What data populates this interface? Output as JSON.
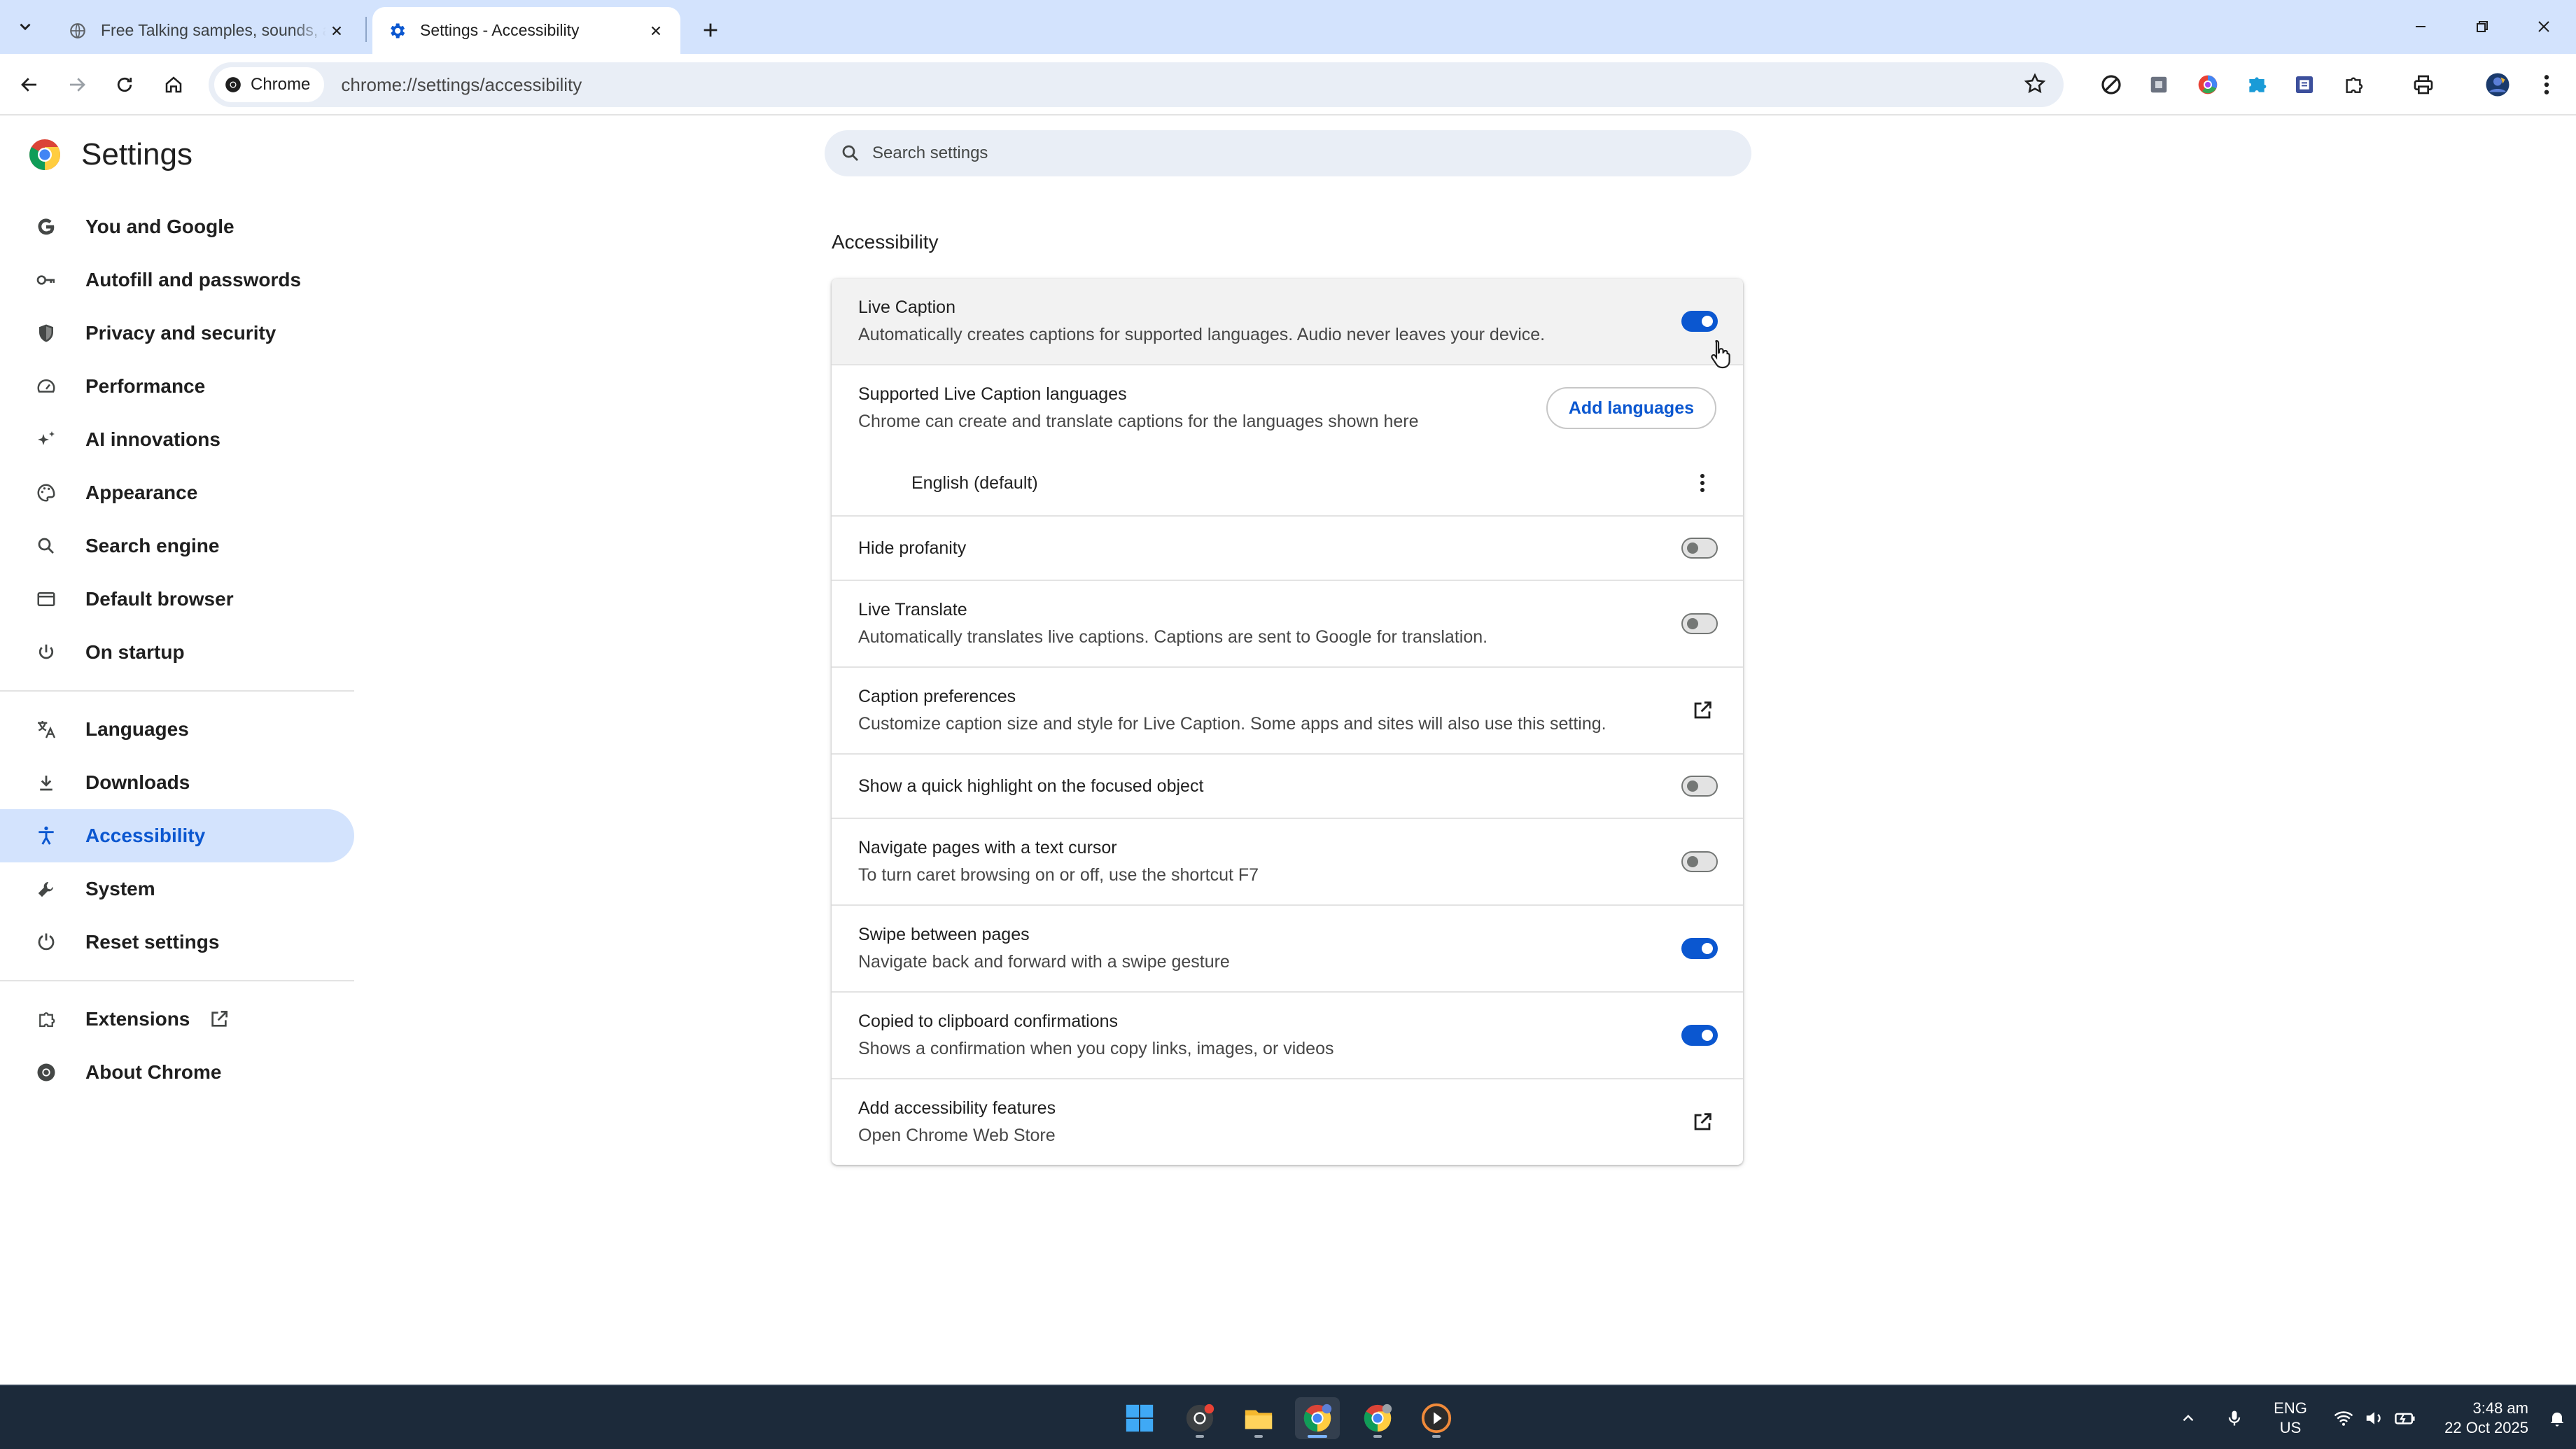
{
  "browser": {
    "tabs": [
      {
        "title": "Free Talking samples, sounds, a",
        "active": false
      },
      {
        "title": "Settings - Accessibility",
        "active": true
      }
    ],
    "omnibox": {
      "chip": "Chrome",
      "url": "chrome://settings/accessibility"
    }
  },
  "settings": {
    "title": "Settings",
    "search_placeholder": "Search settings",
    "nav": [
      {
        "label": "You and Google",
        "icon": "google-g-icon"
      },
      {
        "label": "Autofill and passwords",
        "icon": "key-icon"
      },
      {
        "label": "Privacy and security",
        "icon": "shield-icon"
      },
      {
        "label": "Performance",
        "icon": "speedometer-icon"
      },
      {
        "label": "AI innovations",
        "icon": "sparkle-icon"
      },
      {
        "label": "Appearance",
        "icon": "palette-icon"
      },
      {
        "label": "Search engine",
        "icon": "search-icon"
      },
      {
        "label": "Default browser",
        "icon": "browser-window-icon"
      },
      {
        "label": "On startup",
        "icon": "power-icon"
      },
      {
        "label": "Languages",
        "icon": "translate-icon"
      },
      {
        "label": "Downloads",
        "icon": "download-icon"
      },
      {
        "label": "Accessibility",
        "icon": "accessibility-icon",
        "selected": true
      },
      {
        "label": "System",
        "icon": "wrench-icon"
      },
      {
        "label": "Reset settings",
        "icon": "reset-icon"
      },
      {
        "label": "Extensions",
        "icon": "puzzle-icon"
      },
      {
        "label": "About Chrome",
        "icon": "chrome-icon"
      }
    ],
    "section_title": "Accessibility",
    "rows": {
      "live_caption": {
        "label": "Live Caption",
        "sub": "Automatically creates captions for supported languages. Audio never leaves your device.",
        "on": true
      },
      "supported_langs": {
        "label": "Supported Live Caption languages",
        "sub": "Chrome can create and translate captions for the languages shown here",
        "button": "Add languages"
      },
      "english": {
        "label": "English (default)"
      },
      "hide_profanity": {
        "label": "Hide profanity",
        "on": false
      },
      "live_translate": {
        "label": "Live Translate",
        "sub": "Automatically translates live captions. Captions are sent to Google for translation.",
        "on": false
      },
      "caption_prefs": {
        "label": "Caption preferences",
        "sub": "Customize caption size and style for Live Caption. Some apps and sites will also use this setting."
      },
      "quick_highlight": {
        "label": "Show a quick highlight on the focused object",
        "on": false
      },
      "text_cursor": {
        "label": "Navigate pages with a text cursor",
        "sub": "To turn caret browsing on or off, use the shortcut F7",
        "on": false
      },
      "swipe": {
        "label": "Swipe between pages",
        "sub": "Navigate back and forward with a swipe gesture",
        "on": true
      },
      "clipboard": {
        "label": "Copied to clipboard confirmations",
        "sub": "Shows a confirmation when you copy links, images, or videos",
        "on": true
      },
      "add_features": {
        "label": "Add accessibility features",
        "sub": "Open Chrome Web Store"
      }
    }
  },
  "taskbar": {
    "lang_top": "ENG",
    "lang_bottom": "US",
    "time": "3:48 am",
    "date": "22 Oct 2025"
  },
  "colors": {
    "accent": "#0b57d0",
    "selected_bg": "#d3e3fd",
    "tabstrip": "#d3e3fd",
    "taskbar": "#1c2a3a"
  }
}
